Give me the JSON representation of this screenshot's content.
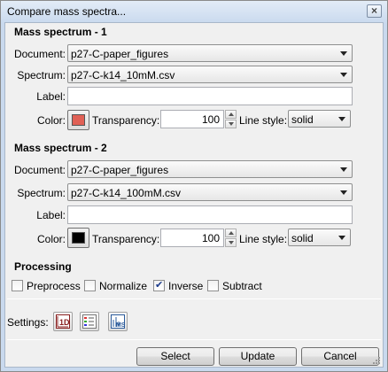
{
  "window": {
    "title": "Compare mass spectra..."
  },
  "spectrum1": {
    "title": "Mass spectrum - 1",
    "document_label": "Document:",
    "document_value": "p27-C-paper_figures",
    "spectrum_label": "Spectrum:",
    "spectrum_value": "p27-C-k14_10mM.csv",
    "label_label": "Label:",
    "label_value": "",
    "color_label": "Color:",
    "color": "#e06055",
    "transparency_label": "Transparency:",
    "transparency_value": "100",
    "linestyle_label": "Line style:",
    "linestyle_value": "solid"
  },
  "spectrum2": {
    "title": "Mass spectrum - 2",
    "document_label": "Document:",
    "document_value": "p27-C-paper_figures",
    "spectrum_label": "Spectrum:",
    "spectrum_value": "p27-C-k14_100mM.csv",
    "label_label": "Label:",
    "label_value": "",
    "color_label": "Color:",
    "color": "#000000",
    "transparency_label": "Transparency:",
    "transparency_value": "100",
    "linestyle_label": "Line style:",
    "linestyle_value": "solid"
  },
  "processing": {
    "title": "Processing",
    "options": [
      {
        "label": "Preprocess",
        "checked": false
      },
      {
        "label": "Normalize",
        "checked": false
      },
      {
        "label": "Inverse",
        "checked": true
      },
      {
        "label": "Subtract",
        "checked": false
      }
    ]
  },
  "settings": {
    "label": "Settings:",
    "icons": [
      "plot-1d-settings-icon",
      "legend-settings-icon",
      "mass-spectrum-settings-icon"
    ],
    "icon_1d_text": "1D",
    "icon_ms_text": "MS"
  },
  "buttons": {
    "select": "Select",
    "update": "Update",
    "cancel": "Cancel"
  }
}
